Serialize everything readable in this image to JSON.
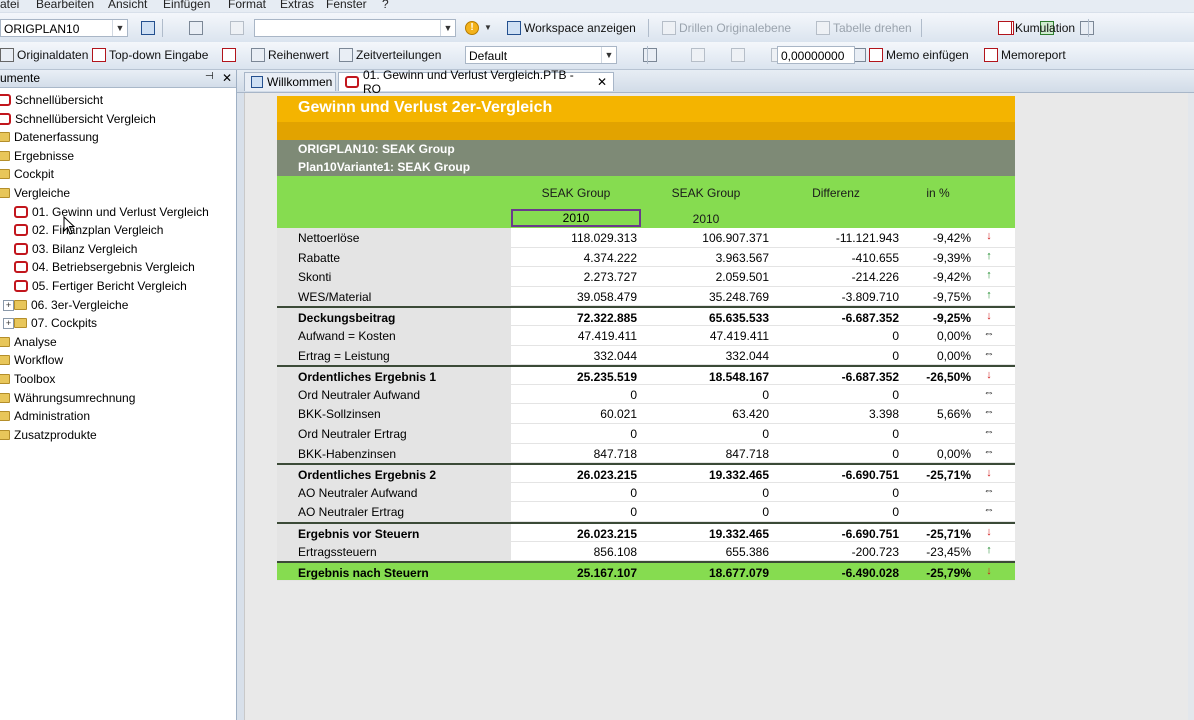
{
  "menu": [
    "atei",
    "Bearbeiten",
    "Ansicht",
    "Einfügen",
    "Format",
    "Extras",
    "Fenster",
    "?"
  ],
  "toolbar1": {
    "plan_combo": "ORIGPLAN10",
    "workspace_label": "Workspace anzeigen",
    "drill_label": "Drillen Originalebene",
    "rotate_label": "Tabelle drehen",
    "cumulation_label": "Kumulation"
  },
  "toolbar2": {
    "originaldaten": "Originaldaten",
    "topdown": "Top-down Eingabe",
    "reihenwert": "Reihenwert",
    "zeitverteilungen": "Zeitverteilungen",
    "default_combo": "Default",
    "value_field": "0,00000000",
    "memo_insert": "Memo einfügen",
    "memoreport": "Memoreport"
  },
  "leftpanel": {
    "title": "umente",
    "items": [
      {
        "label": "Schnellübersicht",
        "type": "report"
      },
      {
        "label": "Schnellübersicht Vergleich",
        "type": "report"
      },
      {
        "label": "Datenerfassung",
        "type": "folder"
      },
      {
        "label": "Ergebnisse",
        "type": "folder"
      },
      {
        "label": "Cockpit",
        "type": "folder"
      },
      {
        "label": "Vergleiche",
        "type": "folder"
      },
      {
        "label": "01. Gewinn und Verlust Vergleich",
        "type": "report"
      },
      {
        "label": "02. Finanzplan Vergleich",
        "type": "report"
      },
      {
        "label": "03. Bilanz Vergleich",
        "type": "report"
      },
      {
        "label": "04. Betriebsergebnis Vergleich",
        "type": "report"
      },
      {
        "label": "05. Fertiger Bericht Vergleich",
        "type": "report"
      },
      {
        "label": "06. 3er-Vergleiche",
        "type": "folder"
      },
      {
        "label": "07. Cockpits",
        "type": "folder"
      },
      {
        "label": "Analyse",
        "type": "folder"
      },
      {
        "label": "Workflow",
        "type": "folder"
      },
      {
        "label": "Toolbox",
        "type": "folder"
      },
      {
        "label": "Währungsumrechnung",
        "type": "folder"
      },
      {
        "label": "Administration",
        "type": "folder"
      },
      {
        "label": "Zusatzprodukte",
        "type": "folder"
      }
    ]
  },
  "tabs": [
    "Willkommen",
    "01. Gewinn und Verlust Vergleich.PTB - RO"
  ],
  "report": {
    "title": "Gewinn und Verlust 2er-Vergleich",
    "scenario1": "ORIGPLAN10: SEAK Group",
    "scenario2": "Plan10Variante1: SEAK Group",
    "headers": [
      "SEAK Group",
      "SEAK Group",
      "Differenz",
      "in %"
    ],
    "years": [
      "2010",
      "2010"
    ],
    "rows": [
      {
        "label": "Nettoerlöse",
        "a": "118.029.313",
        "b": "106.907.371",
        "d": "-11.121.943",
        "p": "-9,42%",
        "arrow": "down",
        "style": "normal"
      },
      {
        "label": "Rabatte",
        "a": "4.374.222",
        "b": "3.963.567",
        "d": "-410.655",
        "p": "-9,39%",
        "arrow": "up",
        "style": "normal"
      },
      {
        "label": "Skonti",
        "a": "2.273.727",
        "b": "2.059.501",
        "d": "-214.226",
        "p": "-9,42%",
        "arrow": "up",
        "style": "normal"
      },
      {
        "label": "WES/Material",
        "a": "39.058.479",
        "b": "35.248.769",
        "d": "-3.809.710",
        "p": "-9,75%",
        "arrow": "up",
        "style": "normal"
      },
      {
        "label": "Deckungsbeitrag",
        "a": "72.322.885",
        "b": "65.635.533",
        "d": "-6.687.352",
        "p": "-9,25%",
        "arrow": "down",
        "style": "bold"
      },
      {
        "label": "Aufwand = Kosten",
        "a": "47.419.411",
        "b": "47.419.411",
        "d": "0",
        "p": "0,00%",
        "arrow": "flat",
        "style": "normal"
      },
      {
        "label": "Ertrag = Leistung",
        "a": "332.044",
        "b": "332.044",
        "d": "0",
        "p": "0,00%",
        "arrow": "flat",
        "style": "normal"
      },
      {
        "label": "Ordentliches Ergebnis 1",
        "a": "25.235.519",
        "b": "18.548.167",
        "d": "-6.687.352",
        "p": "-26,50%",
        "arrow": "down",
        "style": "bold"
      },
      {
        "label": "Ord Neutraler Aufwand",
        "a": "0",
        "b": "0",
        "d": "0",
        "p": "",
        "arrow": "flat",
        "style": "normal"
      },
      {
        "label": "BKK-Sollzinsen",
        "a": "60.021",
        "b": "63.420",
        "d": "3.398",
        "p": "5,66%",
        "arrow": "flat",
        "style": "normal"
      },
      {
        "label": "Ord Neutraler Ertrag",
        "a": "0",
        "b": "0",
        "d": "0",
        "p": "",
        "arrow": "flat",
        "style": "normal"
      },
      {
        "label": "BKK-Habenzinsen",
        "a": "847.718",
        "b": "847.718",
        "d": "0",
        "p": "0,00%",
        "arrow": "flat",
        "style": "normal"
      },
      {
        "label": "Ordentliches Ergebnis 2",
        "a": "26.023.215",
        "b": "19.332.465",
        "d": "-6.690.751",
        "p": "-25,71%",
        "arrow": "down",
        "style": "bold"
      },
      {
        "label": "AO Neutraler Aufwand",
        "a": "0",
        "b": "0",
        "d": "0",
        "p": "",
        "arrow": "flat",
        "style": "normal"
      },
      {
        "label": "AO Neutraler Ertrag",
        "a": "0",
        "b": "0",
        "d": "0",
        "p": "",
        "arrow": "flat",
        "style": "normal"
      },
      {
        "label": "Ergebnis vor Steuern",
        "a": "26.023.215",
        "b": "19.332.465",
        "d": "-6.690.751",
        "p": "-25,71%",
        "arrow": "down",
        "style": "bold"
      },
      {
        "label": "Ertragssteuern",
        "a": "856.108",
        "b": "655.386",
        "d": "-200.723",
        "p": "-23,45%",
        "arrow": "up",
        "style": "normal"
      },
      {
        "label": "Ergebnis nach Steuern",
        "a": "25.167.107",
        "b": "18.677.079",
        "d": "-6.490.028",
        "p": "-25,79%",
        "arrow": "down",
        "style": "final"
      }
    ]
  },
  "colors": {
    "title_band": "#f4b400",
    "scenario_band": "#7e8a76",
    "header_band": "#86dc50",
    "arrow_down": "#d01a1a",
    "arrow_up": "#1c8a2a"
  }
}
